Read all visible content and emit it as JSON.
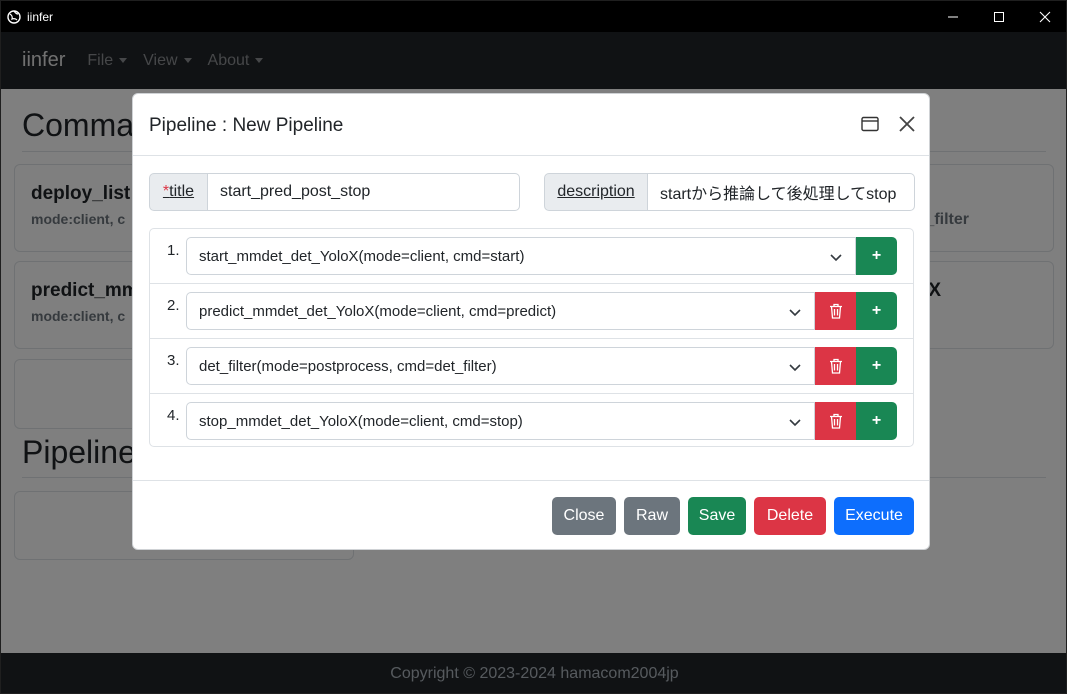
{
  "window": {
    "title": "iinfer"
  },
  "navbar": {
    "brand": "iinfer",
    "menus": [
      {
        "label": "File"
      },
      {
        "label": "View"
      },
      {
        "label": "About"
      }
    ]
  },
  "background": {
    "commands_title": "Comma",
    "pipelines_title": "Pipeline",
    "cards": [
      {
        "title": "deploy_list",
        "sub": "mode:client, c"
      },
      {
        "title": "predict_mm",
        "sub": "mode:client, c"
      }
    ],
    "right_fragments": {
      "filter": "_filter",
      "x": "X"
    }
  },
  "modal": {
    "title": "Pipeline : New Pipeline",
    "title_field": {
      "required_mark": "*",
      "label": "title",
      "value": "start_pred_post_stop"
    },
    "description_field": {
      "label": "description",
      "value": "startから推論して後処理してstop"
    },
    "steps": [
      {
        "num": "1.",
        "value": "start_mmdet_det_YoloX(mode=client, cmd=start)",
        "deletable": false
      },
      {
        "num": "2.",
        "value": "predict_mmdet_det_YoloX(mode=client, cmd=predict)",
        "deletable": true
      },
      {
        "num": "3.",
        "value": "det_filter(mode=postprocess, cmd=det_filter)",
        "deletable": true
      },
      {
        "num": "4.",
        "value": "stop_mmdet_det_YoloX(mode=client, cmd=stop)",
        "deletable": true
      }
    ],
    "add_label": "+",
    "buttons": {
      "close": "Close",
      "raw": "Raw",
      "save": "Save",
      "delete": "Delete",
      "execute": "Execute"
    }
  },
  "footer": {
    "copyright": "Copyright © 2023-2024 hamacom2004jp"
  },
  "colors": {
    "navbar": "#212529",
    "danger": "#dc3545",
    "success": "#198754",
    "secondary": "#6c757d",
    "primary": "#0d6efd"
  }
}
